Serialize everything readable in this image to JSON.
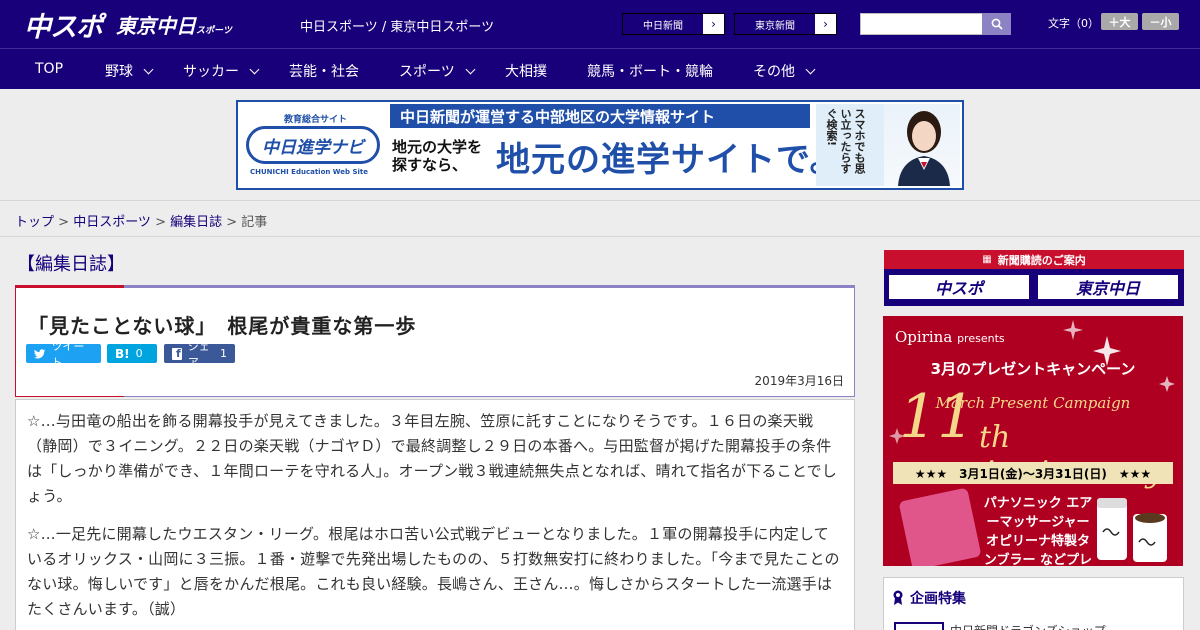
{
  "header": {
    "logo_main": "中スポ",
    "logo_sub": "東京中日",
    "logo_sub_small": "スポーツ",
    "site_names": "中日スポーツ / 東京中日スポーツ",
    "paper_links": [
      "中日新聞",
      "東京新聞"
    ],
    "font_size_label": "文字（0）",
    "font_larger": "＋大",
    "font_smaller": "－小"
  },
  "nav": {
    "items": [
      {
        "label": "TOP",
        "dropdown": false
      },
      {
        "label": "野球",
        "dropdown": true
      },
      {
        "label": "サッカー",
        "dropdown": true
      },
      {
        "label": "芸能・社会",
        "dropdown": false
      },
      {
        "label": "スポーツ",
        "dropdown": true
      },
      {
        "label": "大相撲",
        "dropdown": false
      },
      {
        "label": "競馬・ボート・競輪",
        "dropdown": false
      },
      {
        "label": "その他",
        "dropdown": true
      }
    ]
  },
  "banner": {
    "logo_small": "教育総合サイト",
    "logo_main": "中日進学ナビ",
    "logo_en": "CHUNICHI Education Web Site",
    "headline": "中日新聞が運営する中部地区の大学情報サイト",
    "sub_left": "地元の大学を探すなら、",
    "big": "地元の進学サイトで。",
    "vertical": "スマホでも思い立ったらすぐ検索!"
  },
  "breadcrumb": {
    "items": [
      "トップ",
      "中日スポーツ",
      "編集日誌"
    ],
    "current": "記事"
  },
  "article": {
    "category": "【編集日誌】",
    "headline": "「見たことない球」　根尾が貴重な第一歩",
    "share": {
      "tweet": "ツイート",
      "hatena_count": "0",
      "facebook": "シェア",
      "facebook_count": "1"
    },
    "date": "2019年3月16日",
    "paragraphs": [
      "☆…与田竜の船出を飾る開幕投手が見えてきました。３年目左腕、笠原に託すことになりそうです。１６日の楽天戦（静岡）で３イニング。２２日の楽天戦（ナゴヤＤ）で最終調整し２９日の本番へ。与田監督が掲げた開幕投手の条件は「しっかり準備ができ、１年間ローテを守れる人」。オープン戦３戦連続無失点となれば、晴れて指名が下ることでしょう。",
      "☆…一足先に開幕したウエスタン・リーグ。根尾はホロ苦い公式戦デビューとなりました。１軍の開幕投手に内定しているオリックス・山岡に３三振。１番・遊撃で先発出場したものの、５打数無安打に終わりました。「今まで見たことのない球。悔しいです」と唇をかんだ根尾。これも良い経験。長嶋さん、王さん…。悔しさからスタートした一流選手はたくさんいます。（誠）"
    ]
  },
  "sidebar": {
    "subscribe_title": "新聞購読のご案内",
    "subscribe_buttons": [
      "中スポ",
      "東京中日"
    ],
    "promo": {
      "brand": "Opirina",
      "brand_suffix": "presents",
      "line1": "3月のプレゼントキャンペーン",
      "line2": "March Present Campaign",
      "number": "11",
      "anniversary": "th Anniversary",
      "dates": "★★★　3月1日(金)〜3月31日(日)　★★★",
      "prize": "パナソニック エアーマッサージャー オピリーナ特製タンブラー などプレゼント!"
    },
    "feature_title": "企画特集",
    "feature_item": "中日新聞ドラゴンズショップ"
  }
}
